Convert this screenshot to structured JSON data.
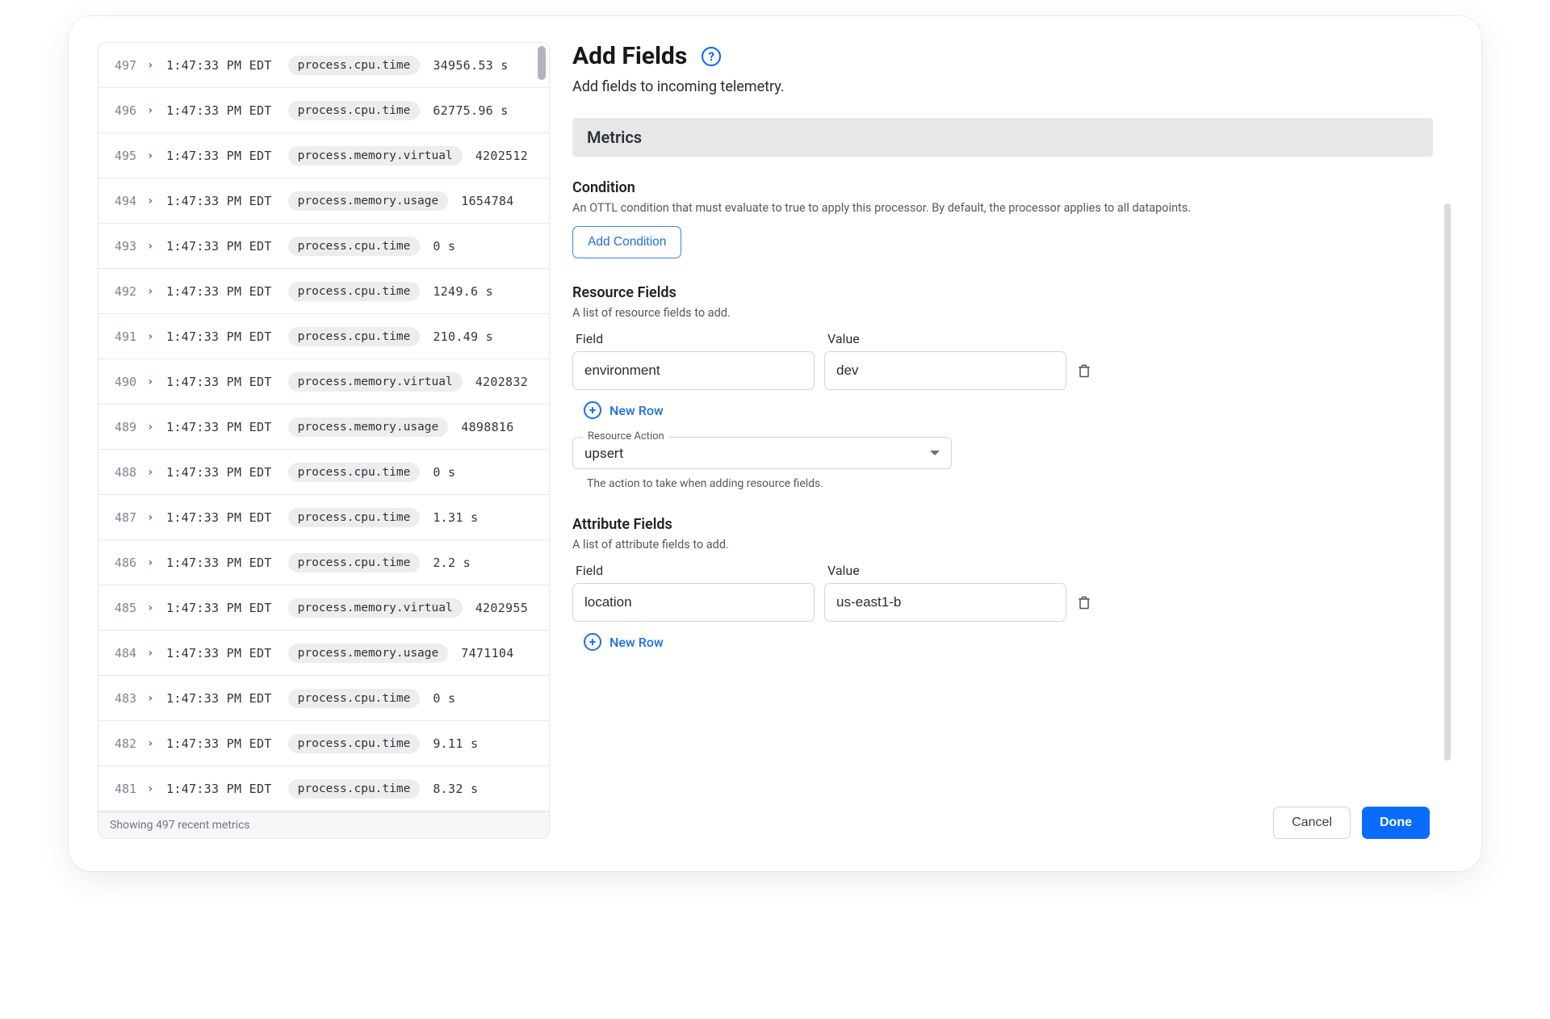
{
  "logs": {
    "footer": "Showing 497 recent metrics",
    "rows": [
      {
        "idx": "497",
        "time": "1:47:33 PM EDT",
        "metric": "process.cpu.time",
        "value": "34956.53 s"
      },
      {
        "idx": "496",
        "time": "1:47:33 PM EDT",
        "metric": "process.cpu.time",
        "value": "62775.96 s"
      },
      {
        "idx": "495",
        "time": "1:47:33 PM EDT",
        "metric": "process.memory.virtual",
        "value": "4202512"
      },
      {
        "idx": "494",
        "time": "1:47:33 PM EDT",
        "metric": "process.memory.usage",
        "value": "1654784"
      },
      {
        "idx": "493",
        "time": "1:47:33 PM EDT",
        "metric": "process.cpu.time",
        "value": "0 s"
      },
      {
        "idx": "492",
        "time": "1:47:33 PM EDT",
        "metric": "process.cpu.time",
        "value": "1249.6 s"
      },
      {
        "idx": "491",
        "time": "1:47:33 PM EDT",
        "metric": "process.cpu.time",
        "value": "210.49 s"
      },
      {
        "idx": "490",
        "time": "1:47:33 PM EDT",
        "metric": "process.memory.virtual",
        "value": "4202832"
      },
      {
        "idx": "489",
        "time": "1:47:33 PM EDT",
        "metric": "process.memory.usage",
        "value": "4898816"
      },
      {
        "idx": "488",
        "time": "1:47:33 PM EDT",
        "metric": "process.cpu.time",
        "value": "0 s"
      },
      {
        "idx": "487",
        "time": "1:47:33 PM EDT",
        "metric": "process.cpu.time",
        "value": "1.31 s"
      },
      {
        "idx": "486",
        "time": "1:47:33 PM EDT",
        "metric": "process.cpu.time",
        "value": "2.2 s"
      },
      {
        "idx": "485",
        "time": "1:47:33 PM EDT",
        "metric": "process.memory.virtual",
        "value": "4202955"
      },
      {
        "idx": "484",
        "time": "1:47:33 PM EDT",
        "metric": "process.memory.usage",
        "value": "7471104"
      },
      {
        "idx": "483",
        "time": "1:47:33 PM EDT",
        "metric": "process.cpu.time",
        "value": "0 s"
      },
      {
        "idx": "482",
        "time": "1:47:33 PM EDT",
        "metric": "process.cpu.time",
        "value": "9.11 s"
      },
      {
        "idx": "481",
        "time": "1:47:33 PM EDT",
        "metric": "process.cpu.time",
        "value": "8.32 s"
      }
    ]
  },
  "panel": {
    "title": "Add Fields",
    "subtitle": "Add fields to incoming telemetry.",
    "band": "Metrics",
    "condition": {
      "title": "Condition",
      "desc": "An OTTL condition that must evaluate to true to apply this processor. By default, the processor applies to all datapoints.",
      "button": "Add Condition"
    },
    "resource": {
      "title": "Resource Fields",
      "desc": "A list of resource fields to add.",
      "field_hdr": "Field",
      "value_hdr": "Value",
      "field": "environment",
      "value": "dev",
      "new_row": "New Row",
      "action_legend": "Resource Action",
      "action_value": "upsert",
      "action_hint": "The action to take when adding resource fields."
    },
    "attribute": {
      "title": "Attribute Fields",
      "desc": "A list of attribute fields to add.",
      "field_hdr": "Field",
      "value_hdr": "Value",
      "field": "location",
      "value": "us-east1-b",
      "new_row": "New Row"
    },
    "actions": {
      "cancel": "Cancel",
      "done": "Done"
    }
  }
}
